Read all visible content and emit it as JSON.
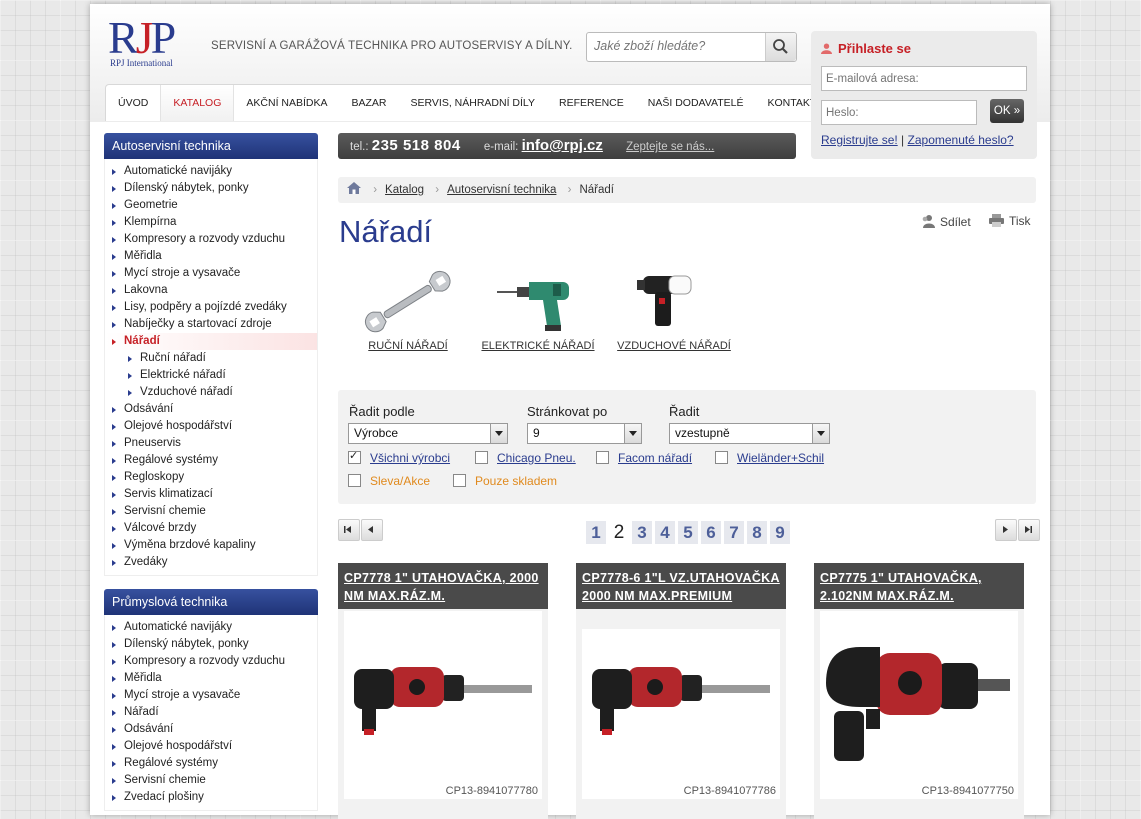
{
  "brand": {
    "logo_letters": [
      "R",
      "J",
      "P"
    ],
    "logo_sub": "RPJ International",
    "tagline": "SERVISNÍ A GARÁŽOVÁ TECHNIKA PRO AUTOSERVISY A DÍLNY."
  },
  "search": {
    "placeholder": "Jaké zboží hledáte?",
    "icon": "search-icon"
  },
  "nav": [
    "ÚVOD",
    "KATALOG",
    "AKČNÍ NABÍDKA",
    "BAZAR",
    "SERVIS, NÁHRADNÍ DÍLY",
    "REFERENCE",
    "NAŠI DODAVATELÉ",
    "KONTAKT"
  ],
  "nav_active": "KATALOG",
  "login": {
    "title": "Přihlaste se",
    "email_placeholder": "E-mailová adresa:",
    "password_placeholder": "Heslo:",
    "ok_label": "OK »",
    "register": "Registrujte se!",
    "separator": "|",
    "forgot": "Zapomenuté heslo?"
  },
  "contact": {
    "tel_label": "tel.:",
    "phone": "235 518 804",
    "mail_label": "e-mail:",
    "mail": "info@rpj.cz",
    "ask": "Zeptejte se nás..."
  },
  "sidebar": [
    {
      "title": "Autoservisní technika",
      "items": [
        {
          "label": "Automatické navijáky"
        },
        {
          "label": "Dílenský nábytek, ponky"
        },
        {
          "label": "Geometrie"
        },
        {
          "label": "Klempírna"
        },
        {
          "label": "Kompresory a rozvody vzduchu"
        },
        {
          "label": "Měřidla"
        },
        {
          "label": "Mycí stroje a vysavače"
        },
        {
          "label": "Lakovna"
        },
        {
          "label": "Lisy, podpěry a pojízdé zvedáky"
        },
        {
          "label": "Nabíječky a startovací zdroje"
        },
        {
          "label": "Nářadí",
          "active": true
        },
        {
          "label": "Ruční nářadí",
          "sub": true
        },
        {
          "label": "Elektrické nářadí",
          "sub": true
        },
        {
          "label": "Vzduchové nářadí",
          "sub": true
        },
        {
          "label": "Odsávání"
        },
        {
          "label": "Olejové hospodářství"
        },
        {
          "label": "Pneuservis"
        },
        {
          "label": "Regálové systémy"
        },
        {
          "label": "Regloskopy"
        },
        {
          "label": "Servis klimatizací"
        },
        {
          "label": "Servisní chemie"
        },
        {
          "label": "Válcové brzdy"
        },
        {
          "label": "Výměna brzdové kapaliny"
        },
        {
          "label": "Zvedáky"
        }
      ]
    },
    {
      "title": "Průmyslová technika",
      "items": [
        {
          "label": "Automatické navijáky"
        },
        {
          "label": "Dílenský nábytek, ponky"
        },
        {
          "label": "Kompresory a rozvody vzduchu"
        },
        {
          "label": "Měřidla"
        },
        {
          "label": "Mycí stroje a vysavače"
        },
        {
          "label": "Nářadí"
        },
        {
          "label": "Odsávání"
        },
        {
          "label": "Olejové hospodářství"
        },
        {
          "label": "Regálové systémy"
        },
        {
          "label": "Servisní chemie"
        },
        {
          "label": "Zvedací plošiny"
        }
      ]
    }
  ],
  "breadcrumb": {
    "home_icon": "home-icon",
    "items": [
      "Katalog",
      "Autoservisní technika",
      "Nářadí"
    ]
  },
  "page": {
    "title": "Nářadí",
    "share": "Sdílet",
    "print": "Tisk"
  },
  "categories": [
    {
      "label": "RUČNÍ NÁŘADÍ",
      "icon": "wrench-icon"
    },
    {
      "label": "ELEKTRICKÉ NÁŘADÍ",
      "icon": "drill-icon"
    },
    {
      "label": "VZDUCHOVÉ NÁŘADÍ",
      "icon": "impact-wrench-icon"
    }
  ],
  "filter": {
    "sort_label": "Řadit podle",
    "sort_value": "Výrobce",
    "per_page_label": "Stránkovat po",
    "per_page_value": "9",
    "order_label": "Řadit",
    "order_value": "vzestupně",
    "checkboxes": [
      {
        "label": "Všichni výrobci",
        "checked": true
      },
      {
        "label": "Chicago Pneu.",
        "checked": false
      },
      {
        "label": "Facom nářadí",
        "checked": false
      },
      {
        "label": "Wieländer+Schil",
        "checked": false
      },
      {
        "label": "Sleva/Akce",
        "checked": false
      },
      {
        "label": "Pouze skladem",
        "checked": false
      }
    ]
  },
  "pager": {
    "pages": [
      "1",
      "2",
      "3",
      "4",
      "5",
      "6",
      "7",
      "8",
      "9"
    ],
    "current": "2"
  },
  "products": [
    {
      "title": "CP7778 1\" UTAHOVAČKA, 2000 NM MAX.RÁZ.M.",
      "code": "CP13-8941077780"
    },
    {
      "title": "CP7778-6 1\"L VZ.UTAHOVAČKA 2000 NM MAX.PREMIUM",
      "code": "CP13-8941077786"
    },
    {
      "title": "CP7775 1\" UTAHOVAČKA, 2.102NM MAX.RÁZ.M.",
      "code": "CP13-8941077750"
    }
  ],
  "colors": {
    "brand_blue": "#2a3c8e",
    "brand_red": "#c62026",
    "accent_orange": "#e08a1e"
  }
}
